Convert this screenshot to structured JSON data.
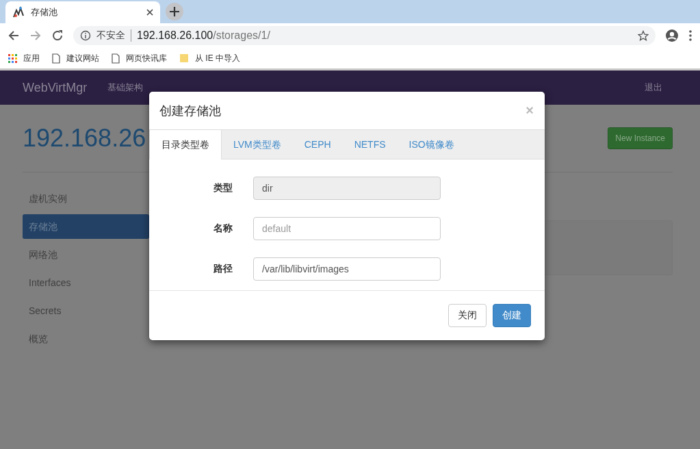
{
  "browser": {
    "tab_title": "存储池",
    "address": {
      "security": "不安全",
      "host": "192.168.26.100",
      "path": "/storages/1/"
    },
    "bookmarks": [
      {
        "kind": "apps",
        "label": "应用"
      },
      {
        "kind": "page",
        "label": "建议网站"
      },
      {
        "kind": "page",
        "label": "网页快讯库"
      },
      {
        "kind": "folder",
        "label": "从 IE 中导入"
      }
    ]
  },
  "navbar": {
    "brand": "WebVirtMgr",
    "links": [
      "基础架构"
    ],
    "logout": "退出"
  },
  "page": {
    "title": "192.168.26",
    "new_button": "New Instance",
    "sidebar": [
      {
        "label": "虚机实例",
        "selected": false
      },
      {
        "label": "存储池",
        "selected": true
      },
      {
        "label": "网络池",
        "selected": false
      },
      {
        "label": "Interfaces",
        "selected": false
      },
      {
        "label": "Secrets",
        "selected": false
      },
      {
        "label": "概览",
        "selected": false
      }
    ]
  },
  "modal": {
    "title": "创建存储池",
    "close": "×",
    "tabs": [
      {
        "label": "目录类型卷",
        "selected": true
      },
      {
        "label": "LVM类型卷",
        "selected": false
      },
      {
        "label": "CEPH",
        "selected": false
      },
      {
        "label": "NETFS",
        "selected": false
      },
      {
        "label": "ISO镜像卷",
        "selected": false
      }
    ],
    "fields": [
      {
        "label": "类型",
        "value": "dir",
        "disabled": true
      },
      {
        "label": "名称",
        "placeholder": "default",
        "disabled": false
      },
      {
        "label": "路径",
        "value": "/var/lib/libvirt/images",
        "disabled": false
      }
    ],
    "buttons": [
      {
        "kind": "default",
        "label": "关闭"
      },
      {
        "kind": "primary",
        "label": "创建"
      }
    ]
  }
}
